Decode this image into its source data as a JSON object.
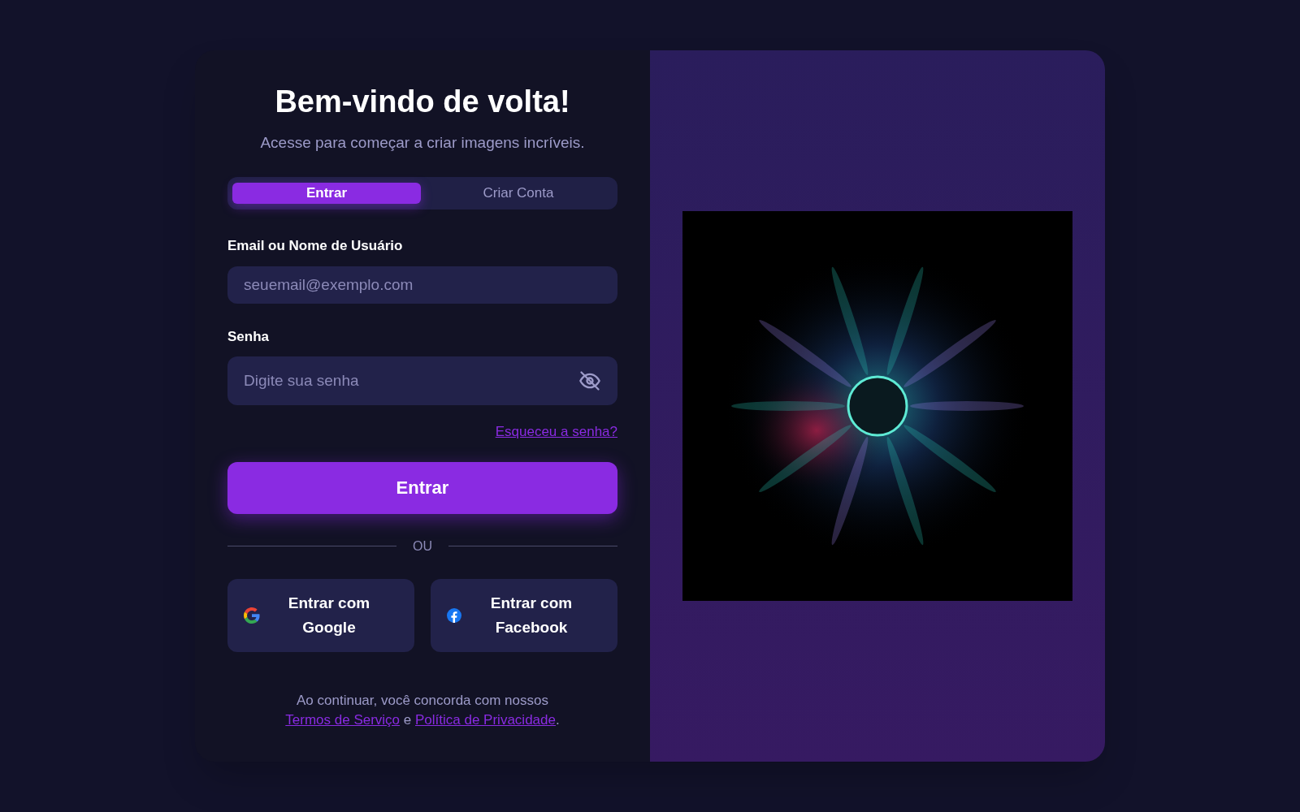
{
  "heading": "Bem-vindo de volta!",
  "subheading": "Acesse para começar a criar imagens incríveis.",
  "tabs": [
    {
      "label": "Entrar",
      "selected": true
    },
    {
      "label": "Criar Conta",
      "selected": false
    }
  ],
  "email_field": {
    "label": "Email ou Nome de Usuário",
    "placeholder": "seuemail@exemplo.com"
  },
  "password_field": {
    "label": "Senha",
    "placeholder": "Digite sua senha"
  },
  "forgot_link": "Esqueceu a senha?",
  "submit_button": "Entrar",
  "divider_text": "OU",
  "social_buttons": [
    {
      "kind": "google",
      "label": "Entrar com Google"
    },
    {
      "kind": "facebook",
      "label": "Entrar com Facebook"
    }
  ],
  "legal": {
    "before": "Ao continuar, você concorda com nossos",
    "terms": "Termos de Serviço",
    "middle": "e",
    "privacy": "Política de Privacidade",
    "after": "."
  }
}
